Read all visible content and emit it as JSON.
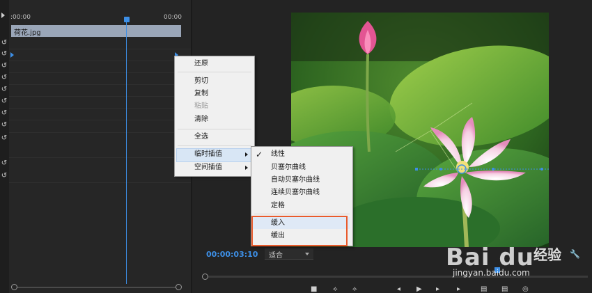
{
  "timeline": {
    "ruler_start": ":00:00",
    "ruler_end": "00:00",
    "clip_name": "荷花.jpg"
  },
  "context_menu": {
    "items": [
      {
        "label": "还原",
        "enabled": true
      },
      {
        "label": "剪切",
        "enabled": true
      },
      {
        "label": "复制",
        "enabled": true
      },
      {
        "label": "粘贴",
        "enabled": false
      },
      {
        "label": "清除",
        "enabled": true
      },
      {
        "label": "全选",
        "enabled": true
      },
      {
        "label": "临时插值",
        "enabled": true,
        "submenu": true,
        "highlighted": true
      },
      {
        "label": "空间插值",
        "enabled": true,
        "submenu": true
      }
    ]
  },
  "submenu": {
    "items": [
      {
        "label": "线性",
        "checked": true
      },
      {
        "label": "贝塞尔曲线"
      },
      {
        "label": "自动贝塞尔曲线"
      },
      {
        "label": "连续贝塞尔曲线"
      },
      {
        "label": "定格"
      },
      {
        "label": "缓入",
        "highlighted": true
      },
      {
        "label": "缓出"
      }
    ]
  },
  "monitor": {
    "timecode": "00:00:03:10",
    "fit_label": "适合"
  },
  "watermark": {
    "logo": "Bai du",
    "jingyan": "经验",
    "url": "jingyan.baidu.com"
  },
  "colors": {
    "accent_blue": "#3d8fe6",
    "highlight_box": "#e95b2c"
  }
}
